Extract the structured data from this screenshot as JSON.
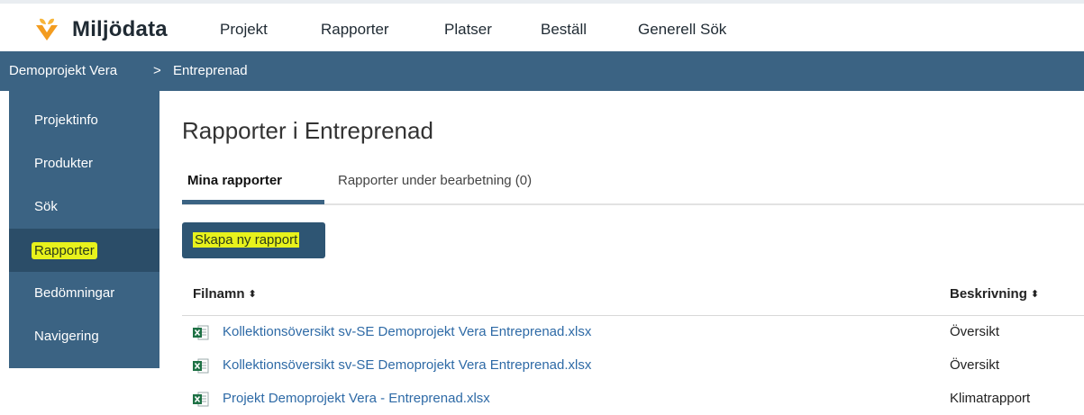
{
  "app": {
    "name": "Miljödata"
  },
  "nav": {
    "items": [
      "Projekt",
      "Rapporter",
      "Platser",
      "Beställ",
      "Generell Sök"
    ]
  },
  "breadcrumb": {
    "project": "Demoprojekt Vera",
    "separator": ">",
    "current": "Entreprenad"
  },
  "sidebar": {
    "items": [
      {
        "label": "Projektinfo"
      },
      {
        "label": "Produkter"
      },
      {
        "label": "Sök"
      },
      {
        "label": "Rapporter",
        "active": true
      },
      {
        "label": "Bedömningar"
      },
      {
        "label": "Navigering"
      }
    ]
  },
  "main": {
    "title": "Rapporter i Entreprenad",
    "tabs": [
      {
        "label": "Mina rapporter",
        "active": true
      },
      {
        "label": "Rapporter under bearbetning (0)"
      }
    ],
    "create_button": "Skapa ny rapport",
    "table": {
      "columns": [
        "Filnamn",
        "Beskrivning"
      ],
      "sort_icon": "⬍",
      "rows": [
        {
          "file": "Kollektionsöversikt sv-SE Demoprojekt Vera Entreprenad.xlsx",
          "description": "Översikt",
          "icon": "excel-file-icon"
        },
        {
          "file": "Kollektionsöversikt sv-SE Demoprojekt Vera Entreprenad.xlsx",
          "description": "Översikt",
          "icon": "excel-file-icon"
        },
        {
          "file": "Projekt Demoprojekt Vera - Entreprenad.xlsx",
          "description": "Klimatrapport",
          "icon": "excel-file-icon"
        }
      ]
    }
  },
  "colors": {
    "primary": "#3b6383",
    "sidebar_active": "#2b4d68",
    "highlight": "#e8f21c",
    "link": "#2e6aa6",
    "logo_orange": "#f39c1f"
  }
}
